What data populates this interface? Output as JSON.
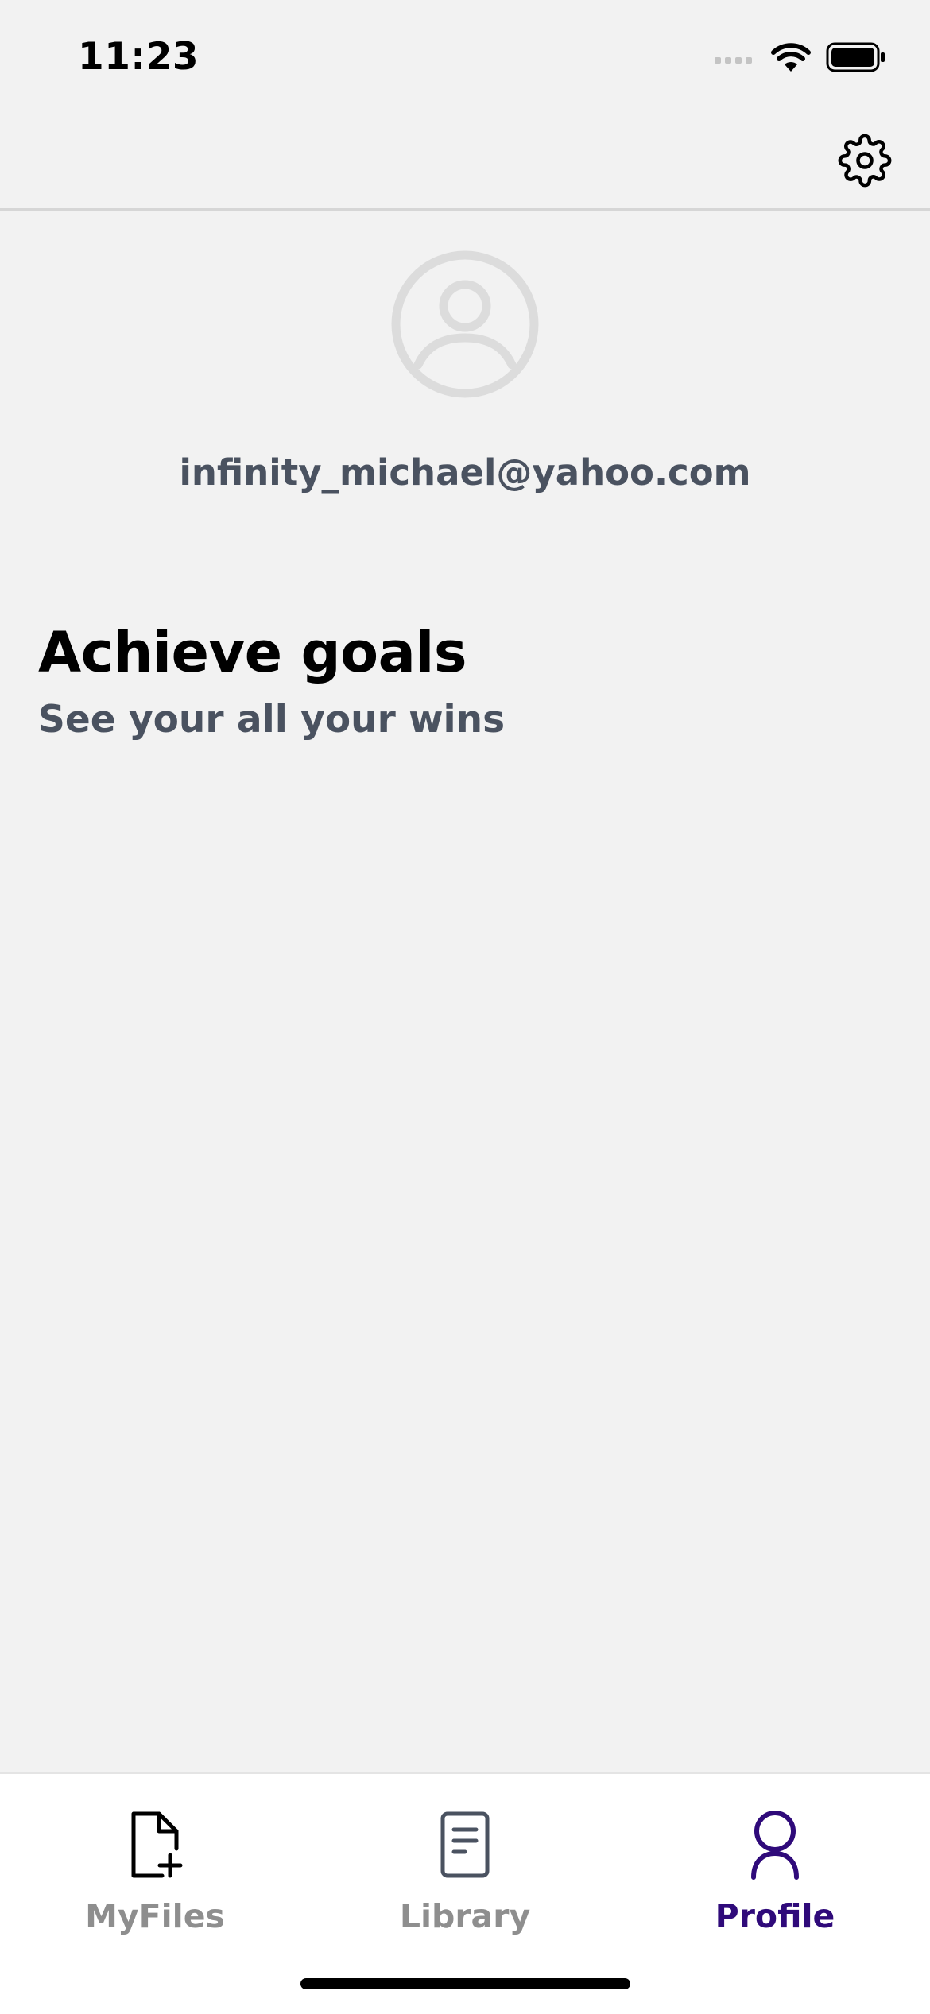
{
  "status_bar": {
    "time": "11:23"
  },
  "header": {
    "settings_icon": "gear-icon"
  },
  "profile": {
    "avatar_icon": "user-circle-icon",
    "email": "infinity_michael@yahoo.com"
  },
  "goals": {
    "title": "Achieve goals",
    "subtitle": "See your all your wins"
  },
  "tab_bar": {
    "tabs": [
      {
        "label": "MyFiles",
        "icon": "file-plus-icon",
        "active": false
      },
      {
        "label": "Library",
        "icon": "document-icon",
        "active": false
      },
      {
        "label": "Profile",
        "icon": "person-icon",
        "active": true
      }
    ]
  },
  "colors": {
    "background": "#f2f2f2",
    "accent": "#2f0a7a",
    "inactive": "#8e8e8e",
    "secondary_text": "#4a5260"
  }
}
